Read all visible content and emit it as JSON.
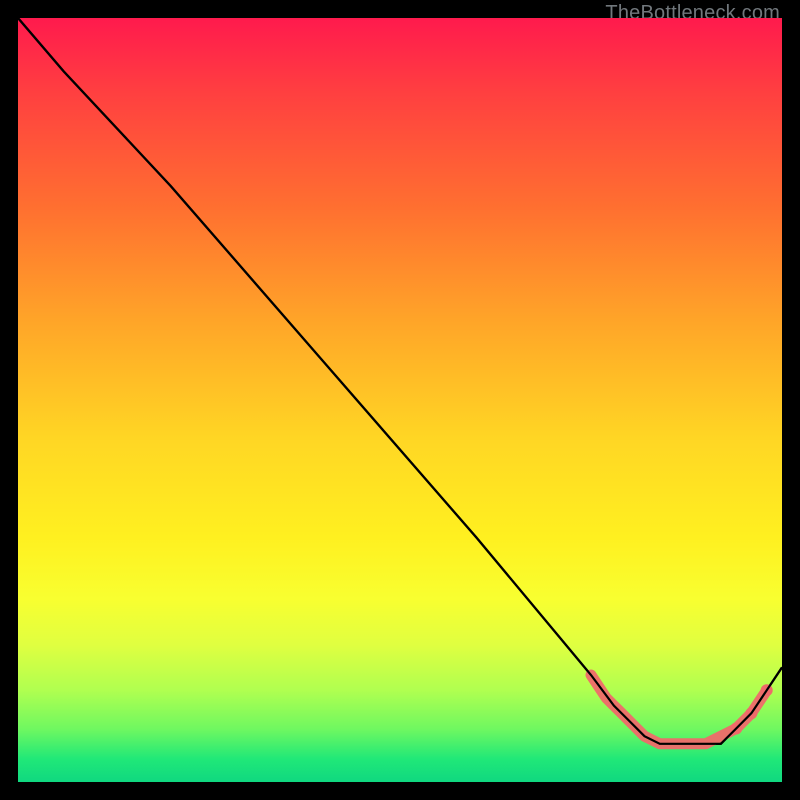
{
  "watermark": "TheBottleneck.com",
  "chart_data": {
    "type": "line",
    "title": "",
    "xlabel": "",
    "ylabel": "",
    "xlim": [
      0,
      100
    ],
    "ylim": [
      0,
      100
    ],
    "series": [
      {
        "name": "curve",
        "x": [
          0,
          6,
          20,
          40,
          60,
          75,
          78,
          80,
          82,
          84,
          86,
          88,
          90,
          92,
          94,
          96,
          98,
          100
        ],
        "y": [
          100,
          93,
          78,
          55,
          32,
          14,
          10,
          8,
          6,
          5,
          5,
          5,
          5,
          5,
          7,
          9,
          12,
          15
        ]
      }
    ],
    "markers": {
      "name": "highlight-dots",
      "color": "#ef6a6a",
      "x": [
        75,
        76,
        77,
        78,
        79,
        80,
        81,
        82,
        83,
        84,
        85,
        86,
        87,
        88,
        89,
        90,
        91,
        94,
        96,
        98
      ],
      "y": [
        14,
        12.5,
        11,
        10,
        9,
        8,
        7,
        6,
        5.5,
        5,
        5,
        5,
        5,
        5,
        5,
        5,
        5.5,
        7,
        9,
        12
      ]
    }
  }
}
